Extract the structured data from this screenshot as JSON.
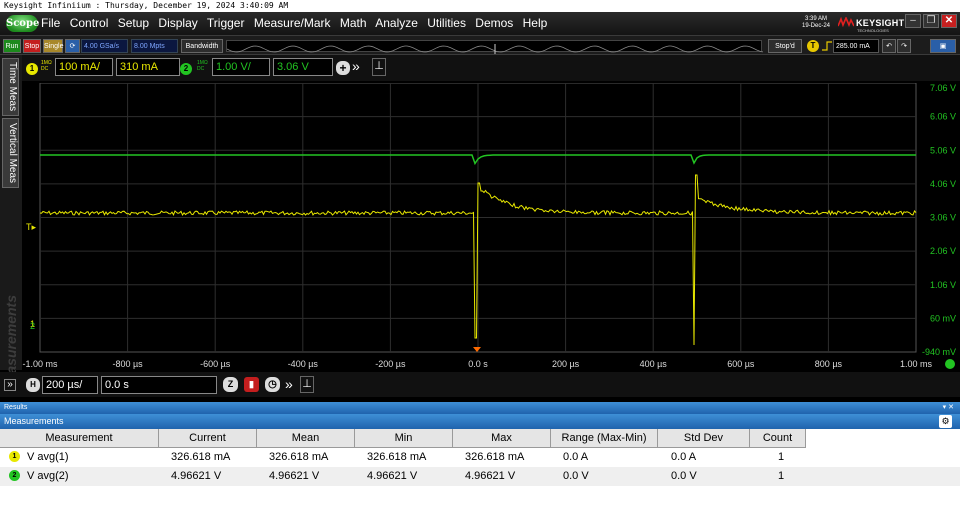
{
  "window_title": "Keysight Infiniium : Thursday, December 19, 2024 3:40:09 AM",
  "menu": {
    "logo_label": "Scope",
    "items": [
      "File",
      "Control",
      "Setup",
      "Display",
      "Trigger",
      "Measure/Mark",
      "Math",
      "Analyze",
      "Utilities",
      "Demos",
      "Help"
    ]
  },
  "clock": {
    "time": "3:39 AM",
    "date": "19-Dec-24"
  },
  "brand": {
    "name": "KEYSIGHT",
    "sub": "TECHNOLOGIES"
  },
  "toolbar": {
    "run": "Run",
    "stop": "Stop",
    "single": "Single",
    "sample_rate": "4.00 GSa/s",
    "memory_depth": "8.00 Mpts",
    "bandwidth": "Bandwidth",
    "stop_status": "Stop'd",
    "trigger_badge": "T",
    "trigger_level": "285.00 mA"
  },
  "channels": [
    {
      "badge": "1",
      "impedance": "1MΩ",
      "coupling": "DC",
      "scale": "100 mA/",
      "offset": "310 mA",
      "color": "#e8e800"
    },
    {
      "badge": "2",
      "impedance": "1MΩ",
      "coupling": "DC",
      "scale": "1.00 V/",
      "offset": "3.06 V",
      "color": "#22c422"
    }
  ],
  "side_tabs": [
    "Time Meas",
    "Vertical Meas"
  ],
  "side_watermark": "Measurements",
  "y_labels": [
    "7.06 V",
    "6.06 V",
    "5.06 V",
    "4.06 V",
    "3.06 V",
    "2.06 V",
    "1.06 V",
    "60 mV",
    "-940 mV"
  ],
  "x_labels": [
    "-1.00 ms",
    "-800 µs",
    "-600 µs",
    "-400 µs",
    "-200 µs",
    "0.0 s",
    "200 µs",
    "400 µs",
    "600 µs",
    "800 µs",
    "1.00 ms"
  ],
  "horizontal": {
    "badge": "H",
    "scale": "200 µs/",
    "position": "0.0 s"
  },
  "results_label": "Results",
  "measurements_label": "Measurements",
  "table": {
    "headers": [
      "Measurement",
      "Current",
      "Mean",
      "Min",
      "Max",
      "Range (Max-Min)",
      "Std Dev",
      "Count"
    ],
    "rows": [
      {
        "badge": "1",
        "name": "V avg(1)",
        "current": "326.618 mA",
        "mean": "326.618 mA",
        "min": "326.618 mA",
        "max": "326.618 mA",
        "range": "0.0 A",
        "std": "0.0 A",
        "count": "1"
      },
      {
        "badge": "2",
        "name": "V avg(2)",
        "current": "4.96621 V",
        "mean": "4.96621 V",
        "min": "4.96621 V",
        "max": "4.96621 V",
        "range": "0.0 V",
        "std": "0.0 V",
        "count": "1"
      }
    ]
  }
}
